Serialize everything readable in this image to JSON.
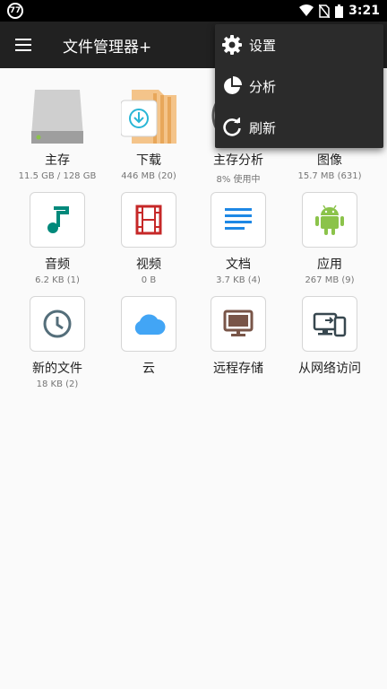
{
  "status_bar": {
    "left_badge": "77",
    "time": "3:21"
  },
  "app_bar": {
    "title": "文件管理器+"
  },
  "tiles": [
    {
      "label": "主存",
      "sub": "11.5 GB / 128 GB",
      "icon": "storage-drive-icon"
    },
    {
      "label": "下载",
      "sub": "446 MB (20)",
      "icon": "download-folder-icon"
    },
    {
      "label": "主存分析",
      "sub": "8% 使用中",
      "icon": "storage-analysis-icon"
    },
    {
      "label": "图像",
      "sub": "15.7 MB (631)",
      "icon": "image-icon"
    },
    {
      "label": "音频",
      "sub": "6.2 KB (1)",
      "icon": "music-note-icon",
      "color": "#00897b"
    },
    {
      "label": "视频",
      "sub": "0 B",
      "icon": "film-icon",
      "color": "#c62828"
    },
    {
      "label": "文档",
      "sub": "3.7 KB (4)",
      "icon": "document-icon",
      "color": "#1e88e5"
    },
    {
      "label": "应用",
      "sub": "267 MB (9)",
      "icon": "android-icon",
      "color": "#8bc34a"
    },
    {
      "label": "新的文件",
      "sub": "18 KB (2)",
      "icon": "clock-icon",
      "color": "#546e7a"
    },
    {
      "label": "云",
      "sub": "",
      "icon": "cloud-icon",
      "color": "#42a5f5"
    },
    {
      "label": "远程存储",
      "sub": "",
      "icon": "monitor-icon",
      "color": "#795548"
    },
    {
      "label": "从网络访问",
      "sub": "",
      "icon": "devices-icon",
      "color": "#37474f"
    }
  ],
  "menu": {
    "items": [
      {
        "label": "设置",
        "icon": "gear-icon"
      },
      {
        "label": "分析",
        "icon": "pie-chart-icon"
      },
      {
        "label": "刷新",
        "icon": "refresh-icon"
      }
    ]
  }
}
